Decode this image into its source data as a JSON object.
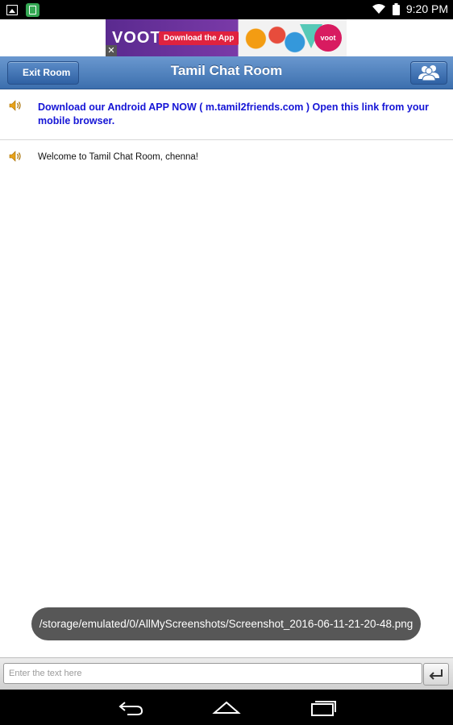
{
  "status_bar": {
    "time": "9:20 PM"
  },
  "ad": {
    "brand": "VOOT",
    "cta": "Download the App",
    "logo_text": "voot",
    "close_glyph": "✕"
  },
  "toolbar": {
    "exit_label": "Exit Room",
    "title": "Tamil Chat Room",
    "users_icon": "users-icon"
  },
  "messages": [
    {
      "icon": "speaker-icon",
      "text": "Download our Android APP NOW ( m.tamil2friends.com ) Open this link from your mobile browser."
    },
    {
      "icon": "speaker-icon",
      "text": "Welcome to Tamil Chat Room, chenna!"
    }
  ],
  "toast": {
    "text": "/storage/emulated/0/AllMyScreenshots/Screenshot_2016-06-11-21-20-48.png"
  },
  "composer": {
    "placeholder": "Enter the text here",
    "send_icon": "enter-icon"
  },
  "nav": {
    "back_icon": "back-icon",
    "home_icon": "home-icon",
    "recents_icon": "recents-icon"
  }
}
